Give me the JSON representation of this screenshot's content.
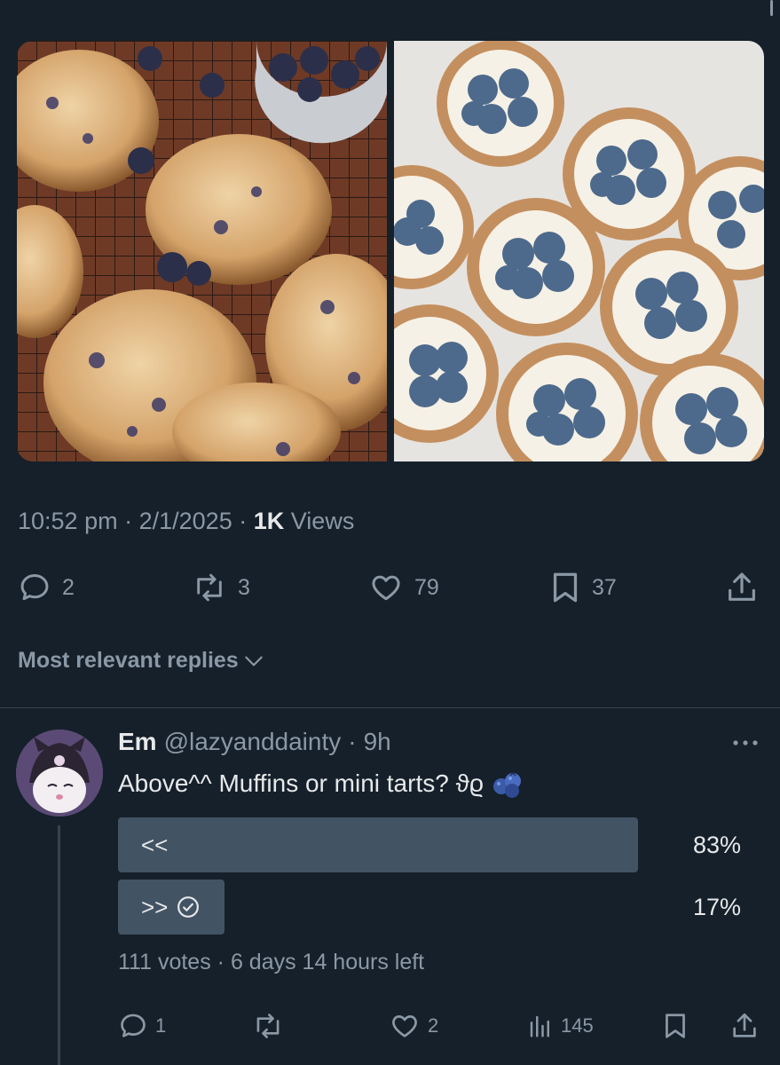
{
  "tweet": {
    "media_alts": [
      "blueberry muffins on a cooling rack",
      "blueberry mini tarts with whipped cream"
    ],
    "time": "10:52 pm",
    "date": "2/1/2025",
    "views_count": "1K",
    "views_label": "Views",
    "sep": "·",
    "actions": {
      "replies": "2",
      "retweets": "3",
      "likes": "79",
      "bookmarks": "37"
    }
  },
  "sort": {
    "label": "Most relevant replies"
  },
  "reply": {
    "name": "Em",
    "handle": "@lazyanddainty",
    "time": "9h",
    "sep": "·",
    "text": "Above^^ Muffins or mini tarts? ϑϱ",
    "emoji_icon": "blueberry-icon",
    "poll": {
      "options": [
        {
          "label": "<<",
          "percent": "83%",
          "fill": 0.83,
          "selected": false
        },
        {
          "label": ">>",
          "percent": "17%",
          "fill": 0.17,
          "selected": true
        }
      ],
      "votes": "111 votes",
      "time_left": "6 days 14 hours left"
    },
    "actions": {
      "replies": "1",
      "retweets": "",
      "likes": "2",
      "views": "145"
    }
  },
  "colors": {
    "background": "#15202b",
    "muted": "#8b98a5",
    "text": "#e7e9ea",
    "poll_bar": "#425364"
  }
}
